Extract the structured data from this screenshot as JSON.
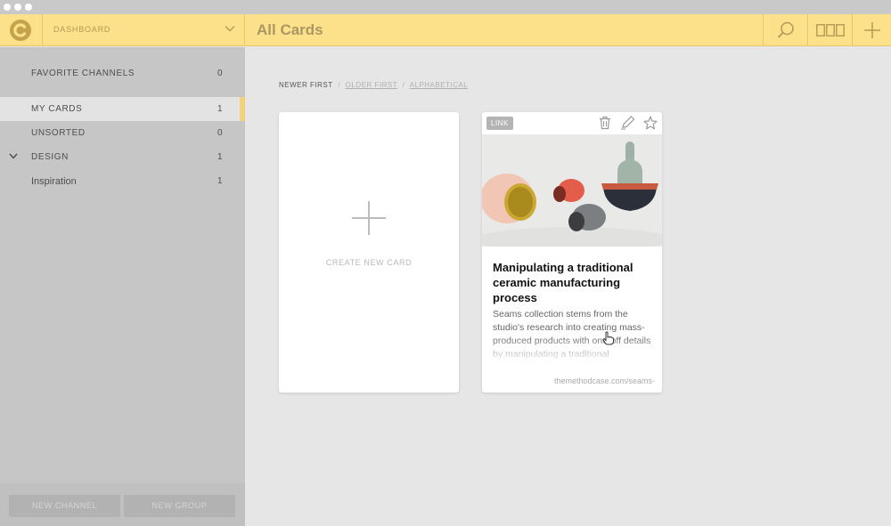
{
  "window": {
    "controls": [
      "close",
      "minimize",
      "maximize"
    ]
  },
  "header": {
    "logo_icon": "app-logo-icon",
    "dashboard_label": "DASHBOARD",
    "title": "All Cards",
    "icons": [
      "search-icon",
      "layout-columns-icon",
      "plus-icon"
    ],
    "accent_color": "#fde08a"
  },
  "sidebar": {
    "items": [
      {
        "label": "FAVORITE CHANNELS",
        "count": "0"
      },
      {
        "label": "MY CARDS",
        "count": "1",
        "active": true
      },
      {
        "label": "UNSORTED",
        "count": "0"
      },
      {
        "label": "DESIGN",
        "count": "1",
        "expanded": true
      },
      {
        "label": "Inspiration",
        "count": "1"
      }
    ],
    "new_channel": "NEW CHANNEL",
    "new_group": "NEW GROUP"
  },
  "sort": {
    "newer": "NEWER FIRST",
    "older": "OLDER FIRST",
    "alpha": "ALPHABETICAL",
    "separator": "/"
  },
  "create_card": {
    "label": "CREATE NEW CARD"
  },
  "link_card": {
    "badge": "LINK",
    "icons": [
      "trash-icon",
      "edit-pencil-icon",
      "star-icon"
    ],
    "title": "Manipulating a traditional ceramic manufacturing process",
    "description": "Seams collection stems from the studio's research into creating mass-produced products with one-off details by manipulating a traditional",
    "url": "themethodcase.com/seams-"
  }
}
